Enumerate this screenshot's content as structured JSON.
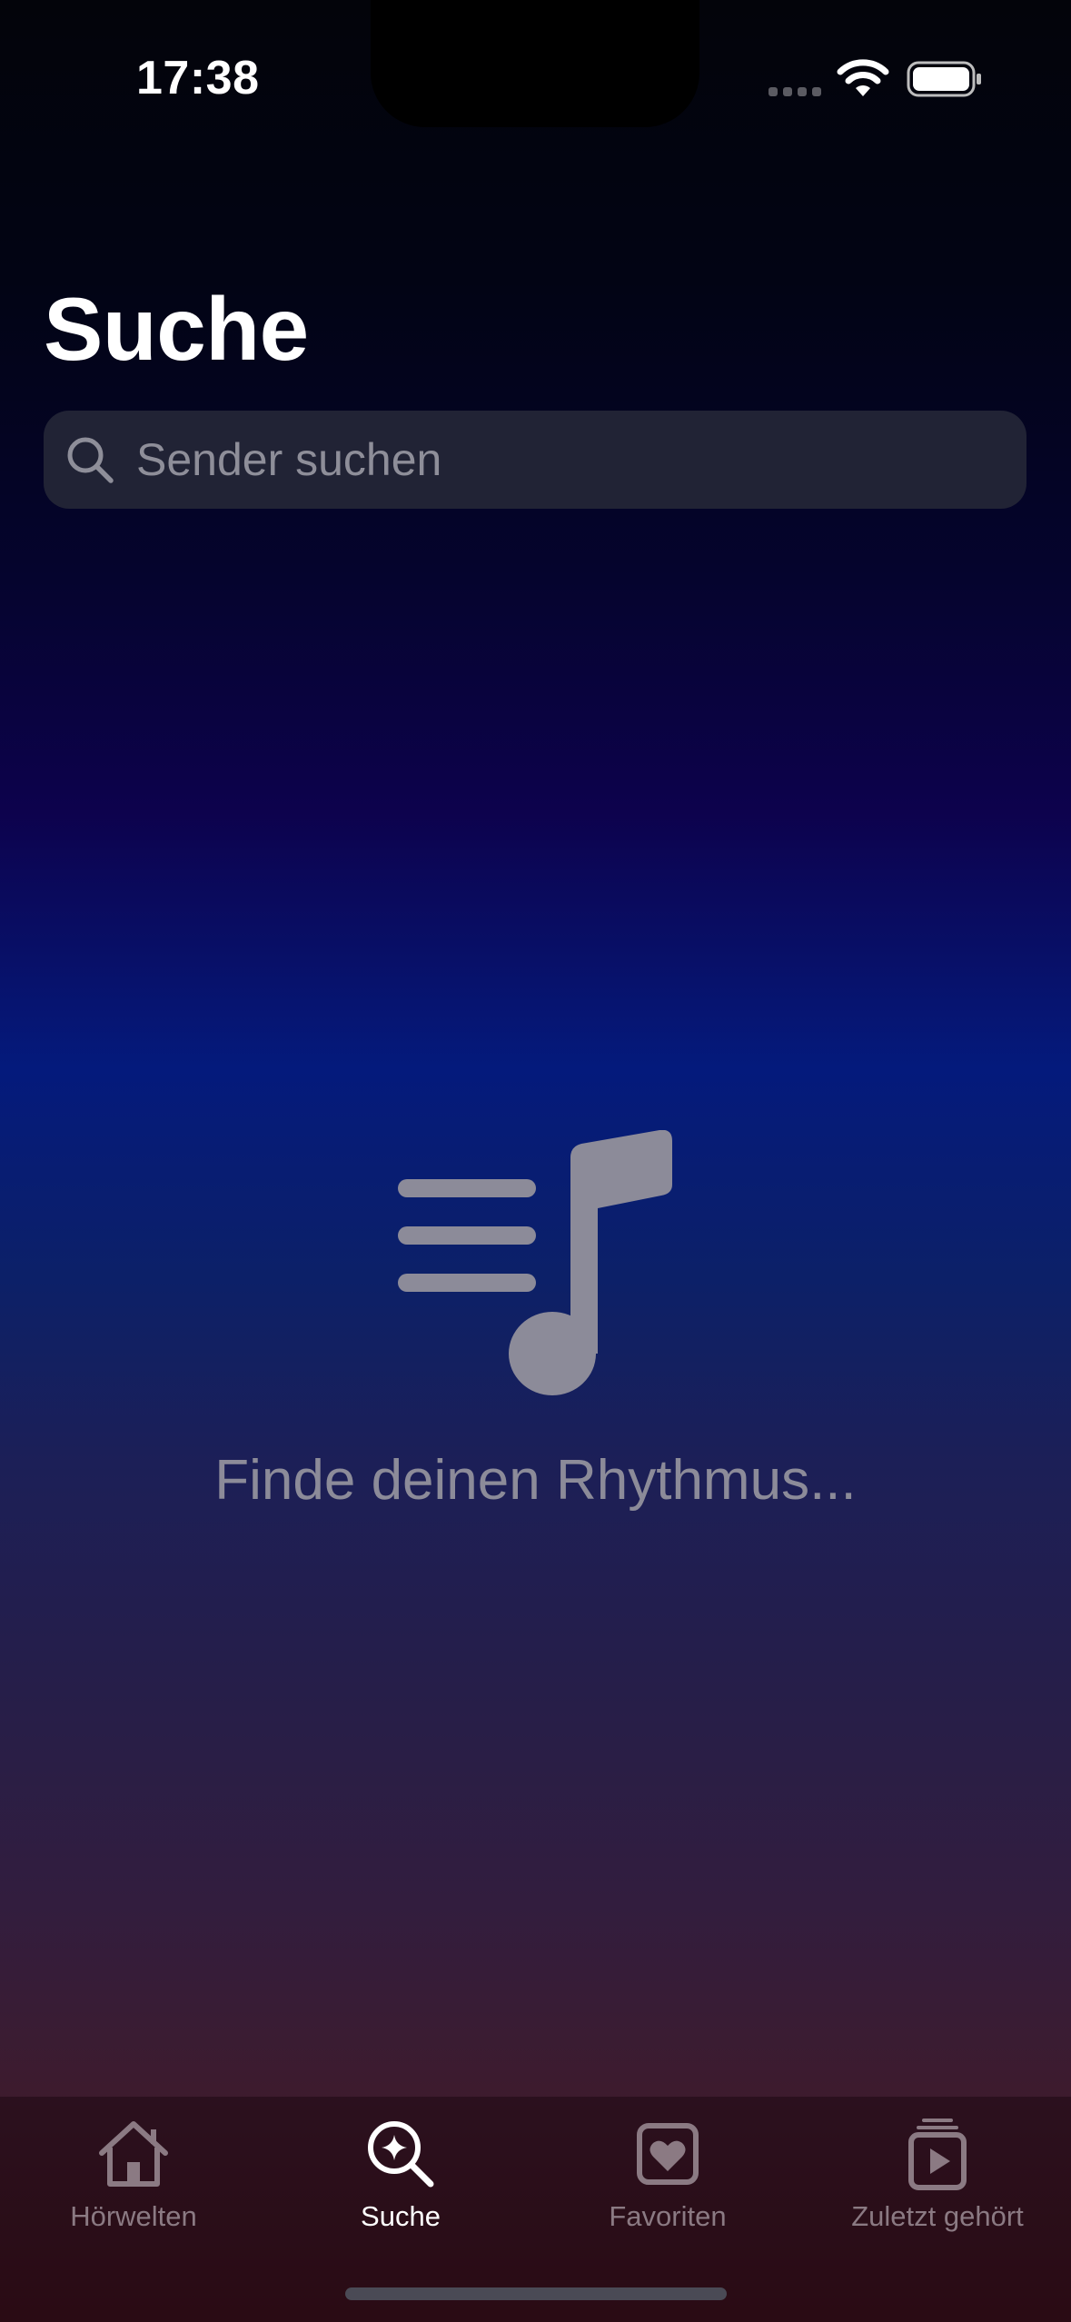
{
  "status_bar": {
    "time": "17:38"
  },
  "header": {
    "title": "Suche"
  },
  "search": {
    "placeholder": "Sender suchen",
    "value": ""
  },
  "empty_state": {
    "icon": "music-note-list-icon",
    "message": "Finde deinen Rhythmus..."
  },
  "tab_bar": {
    "tabs": [
      {
        "label": "Hörwelten",
        "icon": "house-icon",
        "active": false
      },
      {
        "label": "Suche",
        "icon": "magnifier-sparkle-icon",
        "active": true
      },
      {
        "label": "Favoriten",
        "icon": "heart-square-icon",
        "active": false
      },
      {
        "label": "Zuletzt gehört",
        "icon": "play-stack-icon",
        "active": false
      }
    ]
  },
  "colors": {
    "accent_active": "#ffffff",
    "tab_inactive": "#8b7a83",
    "search_field_bg": "#212335",
    "empty_state_gray": "#8c8b99"
  }
}
